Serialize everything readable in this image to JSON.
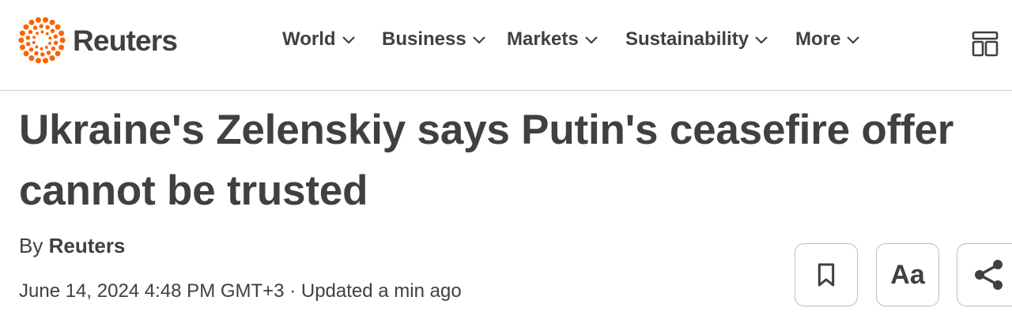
{
  "brand": {
    "name": "Reuters",
    "accent_color": "#fa6400"
  },
  "nav": {
    "items": [
      {
        "label": "World"
      },
      {
        "label": "Business"
      },
      {
        "label": "Markets"
      },
      {
        "label": "Sustainability"
      },
      {
        "label": "More"
      }
    ],
    "layout_icon": "layout-grid-icon"
  },
  "article": {
    "headline": "Ukraine's Zelenskiy says Putin's ceasefire offer cannot be trusted",
    "byline_prefix": "By",
    "author": "Reuters",
    "dateline": "June 14, 2024 4:48 PM GMT+3 · Updated a min ago"
  },
  "actions": {
    "bookmark_icon": "bookmark-icon",
    "text_size_label": "Aa",
    "share_icon": "share-icon"
  }
}
